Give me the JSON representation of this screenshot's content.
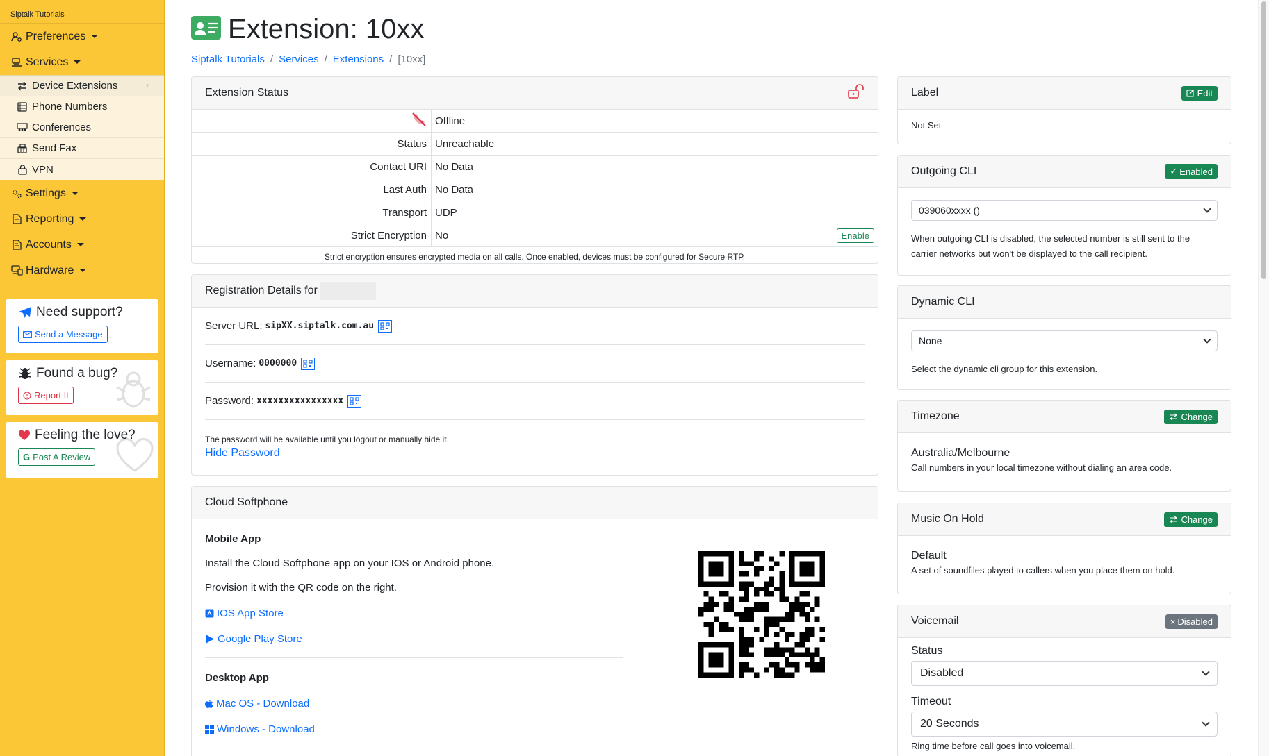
{
  "sidebar": {
    "brand": "Siptalk Tutorials",
    "preferences": "Preferences",
    "services": "Services",
    "sub_items": [
      {
        "label": "Device Extensions",
        "icon": "arrows-swap-icon"
      },
      {
        "label": "Phone Numbers",
        "icon": "number-list-icon"
      },
      {
        "label": "Conferences",
        "icon": "people-group-icon"
      },
      {
        "label": "Send Fax",
        "icon": "fax-icon"
      },
      {
        "label": "VPN",
        "icon": "lock-icon"
      }
    ],
    "settings": "Settings",
    "reporting": "Reporting",
    "accounts": "Accounts",
    "hardware": "Hardware",
    "support_title": "Need support?",
    "support_btn": "Send a Message",
    "bug_title": "Found a bug?",
    "bug_btn": "Report It",
    "love_title": "Feeling the love?",
    "love_btn": "Post A Review"
  },
  "page": {
    "title": "Extension: 10xx",
    "breadcrumb": [
      "Siptalk Tutorials",
      "Services",
      "Extensions",
      "[10xx]"
    ]
  },
  "ext_status": {
    "header": "Extension Status",
    "rows": [
      {
        "key": "",
        "value": "Offline"
      },
      {
        "key": "Status",
        "value": "Unreachable"
      },
      {
        "key": "Contact URI",
        "value": "No Data"
      },
      {
        "key": "Last Auth",
        "value": "No Data"
      },
      {
        "key": "Transport",
        "value": "UDP"
      },
      {
        "key": "Strict Encryption",
        "value": "No"
      }
    ],
    "enable_btn": "Enable",
    "note": "Strict encryption ensures encrypted media on all calls. Once enabled, devices must be configured for Secure RTP."
  },
  "registration": {
    "header": "Registration Details for",
    "server_label": "Server URL:",
    "server_value": "sipXX.siptalk.com.au",
    "username_label": "Username:",
    "username_value": "0000000",
    "password_label": "Password:",
    "password_value": "xxxxxxxxxxxxxxxx",
    "password_note": "The password will be available until you logout or manually hide it.",
    "hide_link": "Hide Password"
  },
  "softphone": {
    "header": "Cloud Softphone",
    "mobile_title": "Mobile App",
    "mobile_p1": "Install the Cloud Softphone app on your IOS or Android phone.",
    "mobile_p2": "Provision it with the QR code on the right.",
    "ios_link": "IOS App Store",
    "play_link": "Google Play Store",
    "desktop_title": "Desktop App",
    "mac_link": "Mac OS - Download",
    "win_link": "Windows - Download"
  },
  "right": {
    "label": {
      "header": "Label",
      "btn": "Edit",
      "value": "Not Set"
    },
    "outgoing": {
      "header": "Outgoing CLI",
      "btn": "Enabled",
      "select": "039060xxxx ()",
      "note": "When outgoing CLI is disabled, the selected number is still sent to the carrier networks but won't be displayed to the call recipient."
    },
    "dynamic": {
      "header": "Dynamic CLI",
      "select": "None",
      "note": "Select the dynamic cli group for this extension."
    },
    "timezone": {
      "header": "Timezone",
      "btn": "Change",
      "value": "Australia/Melbourne",
      "note": "Call numbers in your local timezone without dialing an area code."
    },
    "moh": {
      "header": "Music On Hold",
      "btn": "Change",
      "value": "Default",
      "note": "A set of soundfiles played to callers when you place them on hold."
    },
    "voicemail": {
      "header": "Voicemail",
      "btn": "Disabled",
      "status_label": "Status",
      "status_value": "Disabled",
      "timeout_label": "Timeout",
      "timeout_value": "20 Seconds",
      "note": "Ring time before call goes into voicemail."
    }
  },
  "colors": {
    "sidebar": "#fcc737",
    "link": "#0d6efd",
    "success": "#198754",
    "danger": "#dc3545"
  }
}
